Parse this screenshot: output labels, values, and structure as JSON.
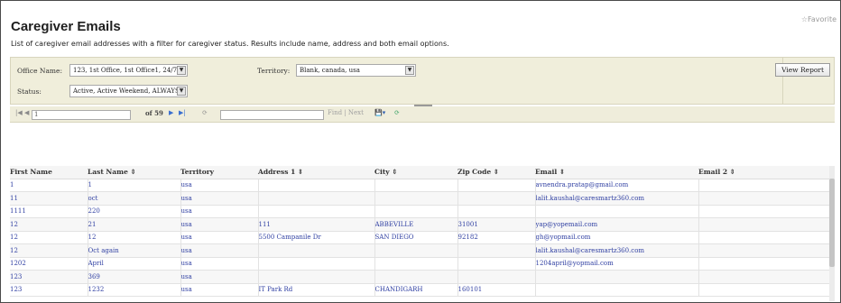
{
  "page": {
    "title": "Caregiver Emails",
    "favorite": "☆Favorite",
    "description": "List of caregiver email addresses with a filter for caregiver status. Results include name, address and both email options."
  },
  "filters": {
    "office_label": "Office Name:",
    "office_value": "123, 1st Office, 1st Office1, 24/7",
    "territory_label": "Territory:",
    "territory_value": "Blank, canada, usa",
    "status_label": "Status:",
    "status_value": "Active, Active Weekend, ALWAYS",
    "view_report": "View Report"
  },
  "toolbar": {
    "first": "|◀",
    "prev": "◀",
    "page_value": "1",
    "of_pages": "of 59",
    "next": "▶",
    "last": "▶|",
    "refresh": "⟳",
    "find_next": "Find | Next",
    "export": "💾▾",
    "refresh2": "⟳"
  },
  "table": {
    "columns": [
      "First Name",
      "Last Name ⇕",
      "Territory",
      "Address 1 ⇕",
      "City ⇕",
      "Zip Code ⇕",
      "Email ⇕",
      "Email 2 ⇕"
    ],
    "rows": [
      [
        "1",
        "1",
        "usa",
        "",
        "",
        "",
        "avnendra.pratap@gmail.com",
        ""
      ],
      [
        "11",
        "oct",
        "usa",
        "",
        "",
        "",
        "lalit.kaushal@caresmartz360.com",
        ""
      ],
      [
        "1111",
        "220",
        "usa",
        "",
        "",
        "",
        "",
        ""
      ],
      [
        "12",
        "21",
        "usa",
        "111",
        "ABBEVILLE",
        "31001",
        "yap@yopemail.com",
        ""
      ],
      [
        "12",
        "12",
        "usa",
        "5500 Campanile Dr",
        "SAN DIEGO",
        "92182",
        "gh@yopmail.com",
        ""
      ],
      [
        "12",
        "Oct again",
        "usa",
        "",
        "",
        "",
        "lalit.kaushal@caresmartz360.com",
        ""
      ],
      [
        "1202",
        "April",
        "usa",
        "",
        "",
        "",
        "1204april@yopmail.com",
        ""
      ],
      [
        "123",
        "369",
        "usa",
        "",
        "",
        "",
        "",
        ""
      ],
      [
        "123",
        "1232",
        "usa",
        "IT Park Rd",
        "CHANDIGARH",
        "160101",
        "",
        ""
      ]
    ]
  },
  "colors": {
    "filter_bg": "#f0eedb",
    "link": "#2f3fa2"
  }
}
